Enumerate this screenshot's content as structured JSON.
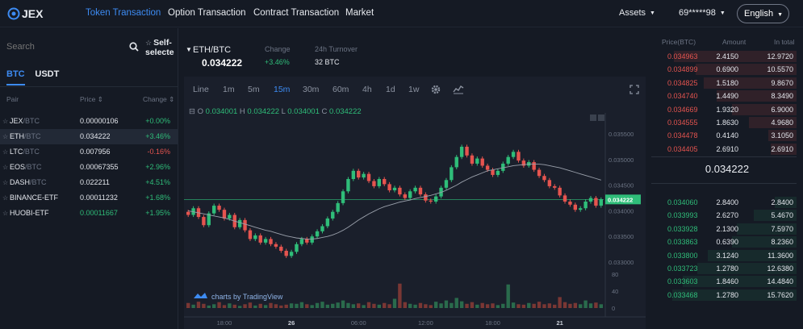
{
  "nav": {
    "logo_text": "JEX",
    "items": [
      {
        "label": "Token Transaction",
        "active": true
      },
      {
        "label": "Option Transaction",
        "active": false
      },
      {
        "label": "Contract Transaction",
        "active": false
      },
      {
        "label": "Market",
        "active": false
      }
    ],
    "assets_label": "Assets",
    "user_label": "69*****98",
    "language": "English"
  },
  "left": {
    "search_placeholder": "Search",
    "self_selected_label": "Self-selecte",
    "tabs": [
      {
        "label": "BTC",
        "active": true
      },
      {
        "label": "USDT",
        "active": false
      }
    ],
    "headers": {
      "pair": "Pair",
      "price": "Price",
      "change": "Change"
    },
    "rows": [
      {
        "base": "JEX",
        "quote": "/BTC",
        "price": "0.00000106",
        "change": "+0.00%",
        "dir": "up"
      },
      {
        "base": "ETH",
        "quote": "/BTC",
        "price": "0.034222",
        "change": "+3.46%",
        "dir": "up"
      },
      {
        "base": "LTC",
        "quote": "/BTC",
        "price": "0.007956",
        "change": "-0.16%",
        "dir": "down"
      },
      {
        "base": "EOS",
        "quote": "/BTC",
        "price": "0.00067355",
        "change": "+2.96%",
        "dir": "up"
      },
      {
        "base": "DASH",
        "quote": "/BTC",
        "price": "0.022211",
        "change": "+4.51%",
        "dir": "up"
      },
      {
        "base": "BINANCE-ETF",
        "quote": "",
        "price": "0.00011232",
        "change": "+1.68%",
        "dir": "up"
      },
      {
        "base": "HUOBI-ETF",
        "quote": "",
        "price": "0.00011667",
        "change": "+1.95%",
        "dir": "up"
      }
    ]
  },
  "pair_header": {
    "pair": "ETH/BTC",
    "price": "0.034222",
    "change_label": "Change",
    "change_value": "+3.46%",
    "turnover_label": "24h Turnover",
    "turnover_value": "32 BTC"
  },
  "chart": {
    "timeframes": [
      "Line",
      "1m",
      "5m",
      "15m",
      "30m",
      "60m",
      "4h",
      "1d",
      "1w"
    ],
    "active_timeframe": "15m",
    "ohlc": {
      "o": "0.034001",
      "h": "0.034222",
      "l": "0.034001",
      "c": "0.034222"
    },
    "price_ticks": [
      "0.035500",
      "0.035000",
      "0.034500",
      "0.034000",
      "0.033500",
      "0.033000"
    ],
    "current_price_tag": "0.034222",
    "volume_ticks": [
      "80",
      "40",
      "0"
    ],
    "time_ticks": [
      "18:00",
      "26",
      "06:00",
      "12:00",
      "18:00",
      "21"
    ],
    "attribution": "charts by TradingView",
    "colors": {
      "up": "#2fbd79",
      "down": "#e5544f"
    }
  },
  "chart_data": {
    "type": "candlestick",
    "ylim": [
      0.033,
      0.0358
    ],
    "open": [
      0.03398,
      0.03392,
      0.03405,
      0.03388,
      0.03372,
      0.03395,
      0.0341,
      0.03402,
      0.03385,
      0.03392,
      0.03368,
      0.03382,
      0.03362,
      0.03345,
      0.03352,
      0.03338,
      0.03345,
      0.03335,
      0.0333,
      0.03322,
      0.03312,
      0.0332,
      0.03335,
      0.03345,
      0.03338,
      0.0335,
      0.0336,
      0.0337,
      0.03385,
      0.03398,
      0.03415,
      0.03438,
      0.03462,
      0.03478,
      0.03465,
      0.03472,
      0.03458,
      0.03448,
      0.03462,
      0.03452,
      0.0344,
      0.03445,
      0.03432,
      0.03425,
      0.03438,
      0.03445,
      0.03432,
      0.0342,
      0.03418,
      0.03428,
      0.03445,
      0.0346,
      0.03485,
      0.03505,
      0.03525,
      0.03508,
      0.03492,
      0.03502,
      0.03488,
      0.0348,
      0.0347,
      0.03478,
      0.03492,
      0.03505,
      0.03515,
      0.03498,
      0.03488,
      0.03495,
      0.0348,
      0.03468,
      0.0346,
      0.03448,
      0.03445,
      0.0343,
      0.03418,
      0.03412,
      0.03402,
      0.03405,
      0.03418,
      0.03425,
      0.0341
    ],
    "close": [
      0.03392,
      0.03405,
      0.03388,
      0.03372,
      0.03395,
      0.0341,
      0.03402,
      0.03385,
      0.03392,
      0.03368,
      0.03382,
      0.03362,
      0.03345,
      0.03352,
      0.03338,
      0.03345,
      0.03335,
      0.0333,
      0.03322,
      0.03312,
      0.0332,
      0.03335,
      0.03345,
      0.03338,
      0.0335,
      0.0336,
      0.0337,
      0.03385,
      0.03398,
      0.03415,
      0.03438,
      0.03462,
      0.03478,
      0.03465,
      0.03472,
      0.03458,
      0.03448,
      0.03462,
      0.03452,
      0.0344,
      0.03445,
      0.03432,
      0.03425,
      0.03438,
      0.03445,
      0.03432,
      0.0342,
      0.03418,
      0.03428,
      0.03445,
      0.0346,
      0.03485,
      0.03505,
      0.03525,
      0.03508,
      0.03492,
      0.03502,
      0.03488,
      0.0348,
      0.0347,
      0.03478,
      0.03492,
      0.03505,
      0.03515,
      0.03498,
      0.03488,
      0.03495,
      0.0348,
      0.03468,
      0.0346,
      0.03448,
      0.03445,
      0.0343,
      0.03418,
      0.03412,
      0.03402,
      0.03405,
      0.03418,
      0.03425,
      0.0341,
      0.03422
    ],
    "volume": [
      12,
      8,
      15,
      10,
      6,
      9,
      14,
      7,
      11,
      8,
      5,
      9,
      13,
      6,
      10,
      7,
      12,
      9,
      6,
      8,
      11,
      10,
      14,
      9,
      7,
      12,
      15,
      8,
      10,
      13,
      18,
      12,
      9,
      11,
      7,
      14,
      10,
      8,
      12,
      9,
      22,
      58,
      14,
      10,
      8,
      12,
      9,
      7,
      15,
      11,
      18,
      12,
      24,
      16,
      10,
      14,
      8,
      12,
      9,
      11,
      7,
      10,
      56,
      13,
      9,
      8,
      12,
      10,
      15,
      9,
      11,
      8,
      26,
      14,
      10,
      12,
      9,
      18,
      11,
      13,
      9
    ],
    "ma": [
      0.034,
      0.03398,
      0.03396,
      0.03394,
      0.03392,
      0.0339,
      0.03388,
      0.03386,
      0.03383,
      0.0338,
      0.03377,
      0.03374,
      0.03371,
      0.03368,
      0.03365,
      0.03362,
      0.0336,
      0.03357,
      0.03354,
      0.03351,
      0.03349,
      0.03347,
      0.03346,
      0.03345,
      0.03345,
      0.03346,
      0.03348,
      0.0335,
      0.03353,
      0.03357,
      0.03362,
      0.03368,
      0.03375,
      0.03382,
      0.03388,
      0.03394,
      0.03399,
      0.03404,
      0.03408,
      0.03411,
      0.03414,
      0.03417,
      0.03419,
      0.03421,
      0.03424,
      0.03426,
      0.03428,
      0.0343,
      0.03433,
      0.03436,
      0.0344,
      0.03445,
      0.0345,
      0.03456,
      0.03461,
      0.03466,
      0.0347,
      0.03474,
      0.03478,
      0.0348,
      0.03482,
      0.03484,
      0.03486,
      0.03488,
      0.03489,
      0.0349,
      0.03491,
      0.03491,
      0.03491,
      0.0349,
      0.03488,
      0.03486,
      0.03484,
      0.03481,
      0.03478,
      0.03475,
      0.03472,
      0.03469,
      0.03466,
      0.03463,
      0.0346
    ]
  },
  "orderbook": {
    "headers": {
      "price": "Price(BTC)",
      "amount": "Amount",
      "total": "In total"
    },
    "asks": [
      {
        "price": "0.034963",
        "amount": "2.4150",
        "total": "12.9720",
        "depth": 0.95
      },
      {
        "price": "0.034899",
        "amount": "0.6900",
        "total": "10.5570",
        "depth": 0.78
      },
      {
        "price": "0.034825",
        "amount": "1.5180",
        "total": "9.8670",
        "depth": 0.72
      },
      {
        "price": "0.034740",
        "amount": "1.4490",
        "total": "8.3490",
        "depth": 0.62
      },
      {
        "price": "0.034669",
        "amount": "1.9320",
        "total": "6.9000",
        "depth": 0.5
      },
      {
        "price": "0.034555",
        "amount": "1.8630",
        "total": "4.9680",
        "depth": 0.37
      },
      {
        "price": "0.034478",
        "amount": "0.4140",
        "total": "3.1050",
        "depth": 0.22
      },
      {
        "price": "0.034405",
        "amount": "2.6910",
        "total": "2.6910",
        "depth": 0.2
      }
    ],
    "mid_price": "0.034222",
    "bids": [
      {
        "price": "0.034060",
        "amount": "2.8400",
        "total": "2.8400",
        "depth": 0.17
      },
      {
        "price": "0.033993",
        "amount": "2.6270",
        "total": "5.4670",
        "depth": 0.33
      },
      {
        "price": "0.033928",
        "amount": "2.1300",
        "total": "7.5970",
        "depth": 0.46
      },
      {
        "price": "0.033863",
        "amount": "0.6390",
        "total": "8.2360",
        "depth": 0.5
      },
      {
        "price": "0.033800",
        "amount": "3.1240",
        "total": "11.3600",
        "depth": 0.69
      },
      {
        "price": "0.033723",
        "amount": "1.2780",
        "total": "12.6380",
        "depth": 0.77
      },
      {
        "price": "0.033603",
        "amount": "1.8460",
        "total": "14.4840",
        "depth": 0.88
      },
      {
        "price": "0.033468",
        "amount": "1.2780",
        "total": "15.7620",
        "depth": 0.96
      }
    ]
  }
}
